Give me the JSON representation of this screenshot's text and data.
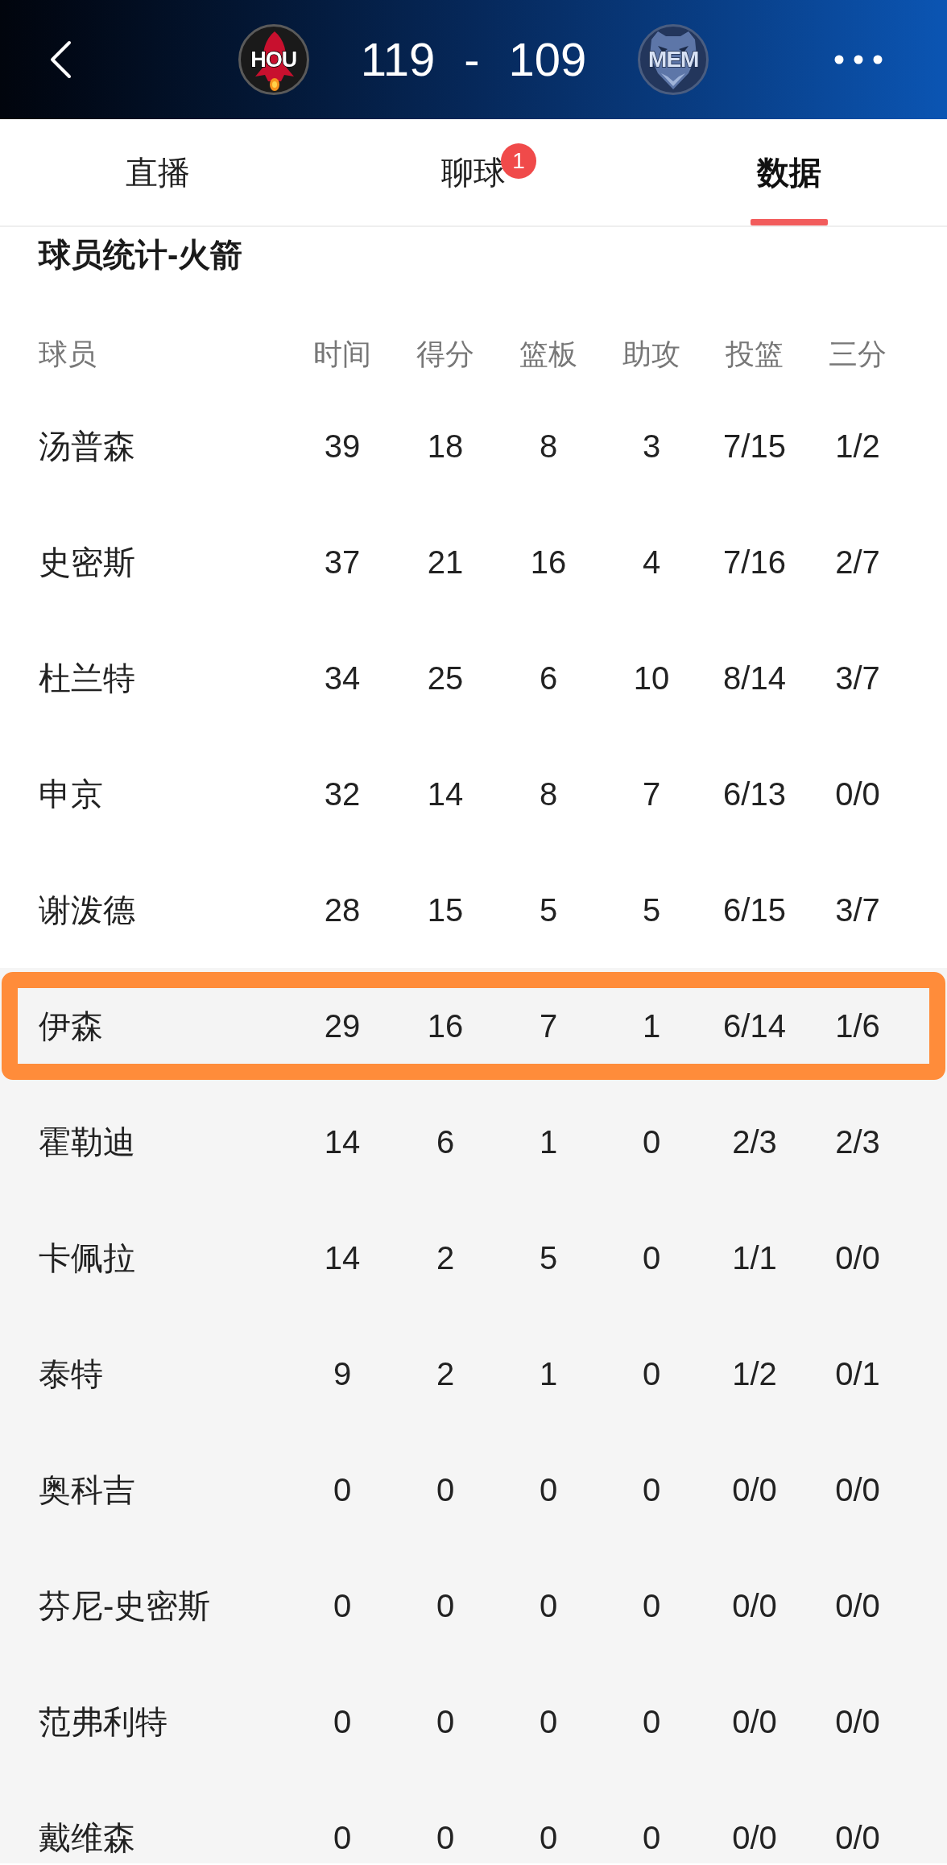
{
  "header": {
    "home_team": {
      "abbreviation": "HOU"
    },
    "score": {
      "home": "119",
      "separator": "-",
      "away": "109"
    },
    "away_team": {
      "abbreviation": "MEM"
    }
  },
  "tabs": [
    {
      "label": "直播",
      "selected": false
    },
    {
      "label": "聊球",
      "selected": false,
      "badge": "1"
    },
    {
      "label": "数据",
      "selected": true
    }
  ],
  "section_title": "球员统计-火箭",
  "table": {
    "columns": [
      "球员",
      "时间",
      "得分",
      "篮板",
      "助攻",
      "投篮",
      "三分"
    ],
    "starters": [
      {
        "name": "汤普森",
        "values": [
          "39",
          "18",
          "8",
          "3",
          "7/15",
          "1/2"
        ],
        "highlighted": false
      },
      {
        "name": "史密斯",
        "values": [
          "37",
          "21",
          "16",
          "4",
          "7/16",
          "2/7"
        ],
        "highlighted": false
      },
      {
        "name": "杜兰特",
        "values": [
          "34",
          "25",
          "6",
          "10",
          "8/14",
          "3/7"
        ],
        "highlighted": false
      },
      {
        "name": "申京",
        "values": [
          "32",
          "14",
          "8",
          "7",
          "6/13",
          "0/0"
        ],
        "highlighted": false
      },
      {
        "name": "谢泼德",
        "values": [
          "28",
          "15",
          "5",
          "5",
          "6/15",
          "3/7"
        ],
        "highlighted": false
      }
    ],
    "bench": [
      {
        "name": "伊森",
        "values": [
          "29",
          "16",
          "7",
          "1",
          "6/14",
          "1/6"
        ],
        "highlighted": true
      },
      {
        "name": "霍勒迪",
        "values": [
          "14",
          "6",
          "1",
          "0",
          "2/3",
          "2/3"
        ],
        "highlighted": false
      },
      {
        "name": "卡佩拉",
        "values": [
          "14",
          "2",
          "5",
          "0",
          "1/1",
          "0/0"
        ],
        "highlighted": false
      },
      {
        "name": "泰特",
        "values": [
          "9",
          "2",
          "1",
          "0",
          "1/2",
          "0/1"
        ],
        "highlighted": false
      },
      {
        "name": "奥科吉",
        "values": [
          "0",
          "0",
          "0",
          "0",
          "0/0",
          "0/0"
        ],
        "highlighted": false
      },
      {
        "name": "芬尼-史密斯",
        "values": [
          "0",
          "0",
          "0",
          "0",
          "0/0",
          "0/0"
        ],
        "highlighted": false
      },
      {
        "name": "范弗利特",
        "values": [
          "0",
          "0",
          "0",
          "0",
          "0/0",
          "0/0"
        ],
        "highlighted": false
      },
      {
        "name": "戴维森",
        "values": [
          "0",
          "0",
          "0",
          "0",
          "0/0",
          "0/0"
        ],
        "highlighted": false
      }
    ]
  }
}
